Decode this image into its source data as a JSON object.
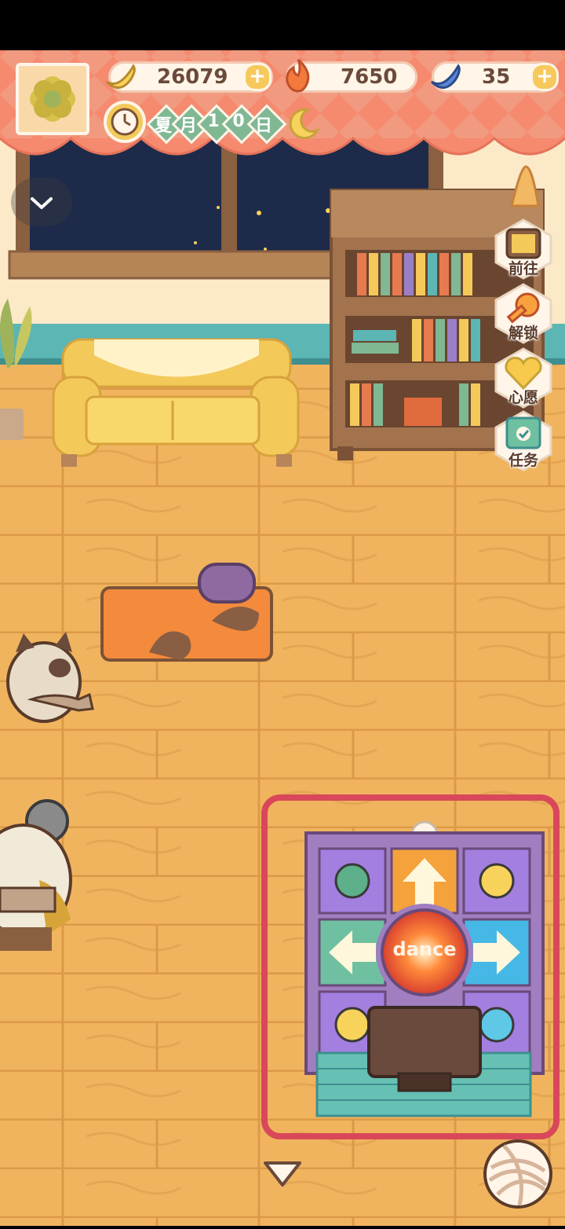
{
  "currencies": {
    "banana": {
      "value": "26079",
      "icon": "banana-icon"
    },
    "fire": {
      "value": "7650",
      "icon": "flame-icon"
    },
    "blue_banana": {
      "value": "35",
      "icon": "blue-banana-icon"
    },
    "plus": "+"
  },
  "date": {
    "season": "夏",
    "month": "月",
    "d1": "1",
    "d2": "0",
    "day": "日"
  },
  "side_menu": {
    "goto": "前往",
    "unlock": "解锁",
    "wish": "心愿",
    "task": "任务"
  },
  "dance_pad_label": "dance",
  "colors": {
    "highlight": "#d9485a",
    "floor": "#f0b860",
    "wall": "#fbe9c8",
    "night": "#1d2a4a"
  }
}
